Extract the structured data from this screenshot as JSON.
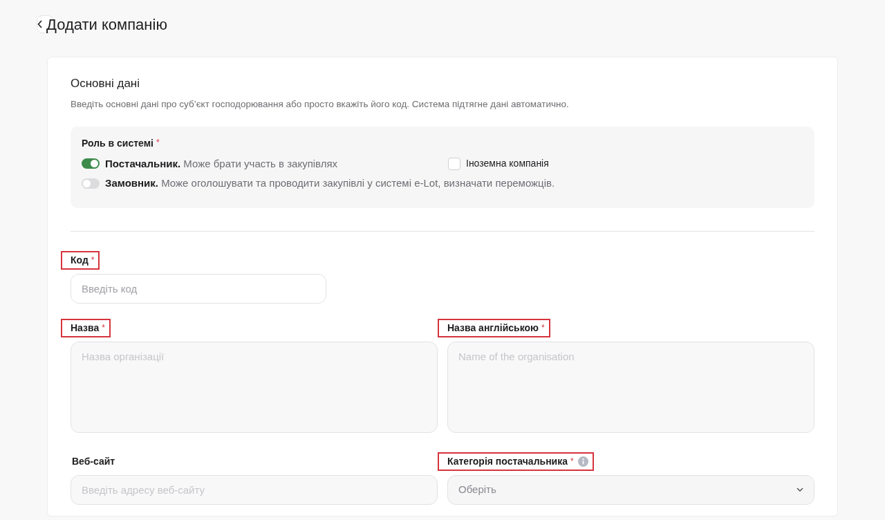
{
  "header": {
    "title": "Додати компанію"
  },
  "section": {
    "title": "Основні дані",
    "subtitle": "Введіть основні дані про суб’єкт господорювання або просто вкажіть його код. Система підтягне дані автоматично."
  },
  "role": {
    "label": "Роль в системі",
    "required_mark": "*",
    "options": [
      {
        "name": "Постачальник.",
        "description": "Може брати участь в закупівлях",
        "on": true
      },
      {
        "name": "Замовник.",
        "description": "Може оголошувати та проводити закупівлі у системі e-Lot, визначати переможців.",
        "on": false
      }
    ],
    "foreign": {
      "label": "Іноземна компанія",
      "checked": false
    }
  },
  "fields": [
    {
      "kind": "input",
      "label": "Код",
      "required_mark": "*",
      "placeholder": "Введіть код",
      "highlighted": true,
      "disabled": false
    },
    {
      "kind": "textarea",
      "label": "Назва",
      "required_mark": "*",
      "placeholder": "Назва організації",
      "highlighted": true,
      "disabled": true
    },
    {
      "kind": "textarea",
      "label": "Назва англійською",
      "required_mark": "*",
      "placeholder": "Name of the organisation",
      "highlighted": true,
      "disabled": true
    },
    {
      "kind": "input",
      "label": "Веб-сайт",
      "placeholder": "Введіть адресу веб-сайту",
      "highlighted": false,
      "disabled": true
    },
    {
      "kind": "select",
      "label": "Категорія постачальника",
      "required_mark": "*",
      "value": "Оберіть",
      "highlighted": true,
      "disabled": true,
      "info": true
    }
  ]
}
